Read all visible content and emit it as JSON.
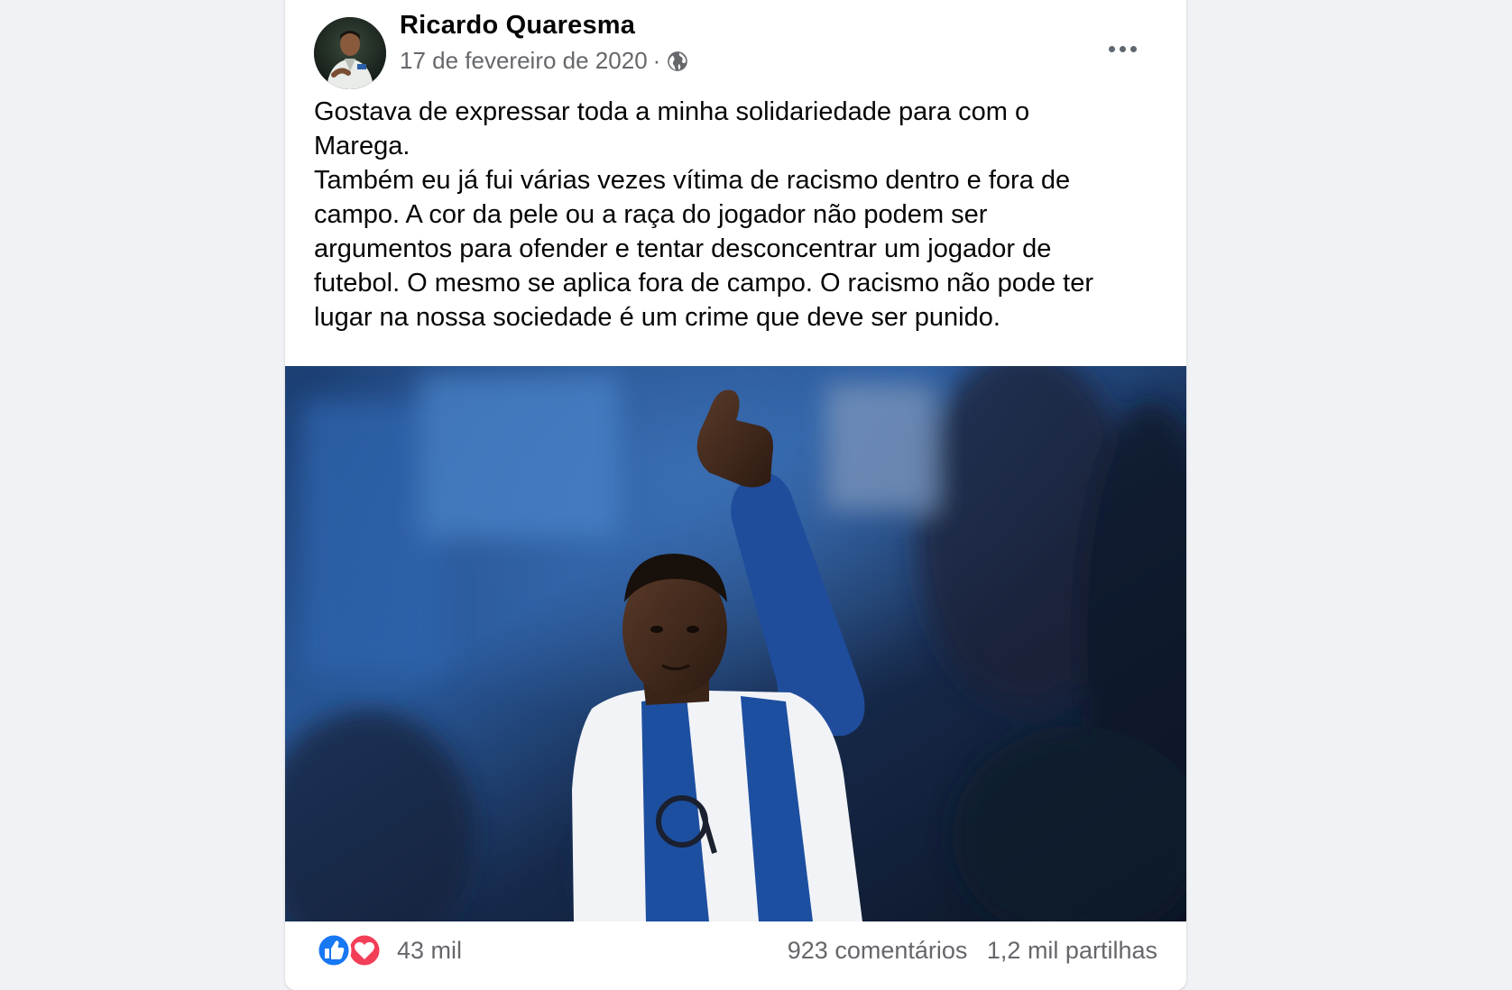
{
  "post": {
    "author": "Ricardo Quaresma",
    "date": "17 de fevereiro de 2020",
    "separator": "·",
    "privacy_icon": "globe-icon",
    "more_icon": "more-options-icon",
    "text": "Gostava de expressar toda a minha solidariedade para com o\nMarega.\nTambém eu já fui várias vezes vítima de racismo dentro e fora de\ncampo. A cor da pele ou a raça do jogador não podem ser\nargumentos para ofender e tentar desconcentrar um jogador de\nfutebol. O mesmo se aplica fora de campo. O racismo não pode ter\nlugar na nossa sociedade é um crime que deve ser punido.",
    "photo_icon": "photo-football-player-thumbs-up"
  },
  "engagement": {
    "reaction_icons": [
      "like-icon",
      "love-icon"
    ],
    "reactions": "43 mil",
    "comments": "923 comentários",
    "shares": "1,2 mil partilhas"
  },
  "colors": {
    "like_blue": "#1877f2",
    "love_red": "#f33e58",
    "secondary_text": "#65676b",
    "background": "#f0f2f5",
    "jersey_blue": "#1d4fa0"
  }
}
